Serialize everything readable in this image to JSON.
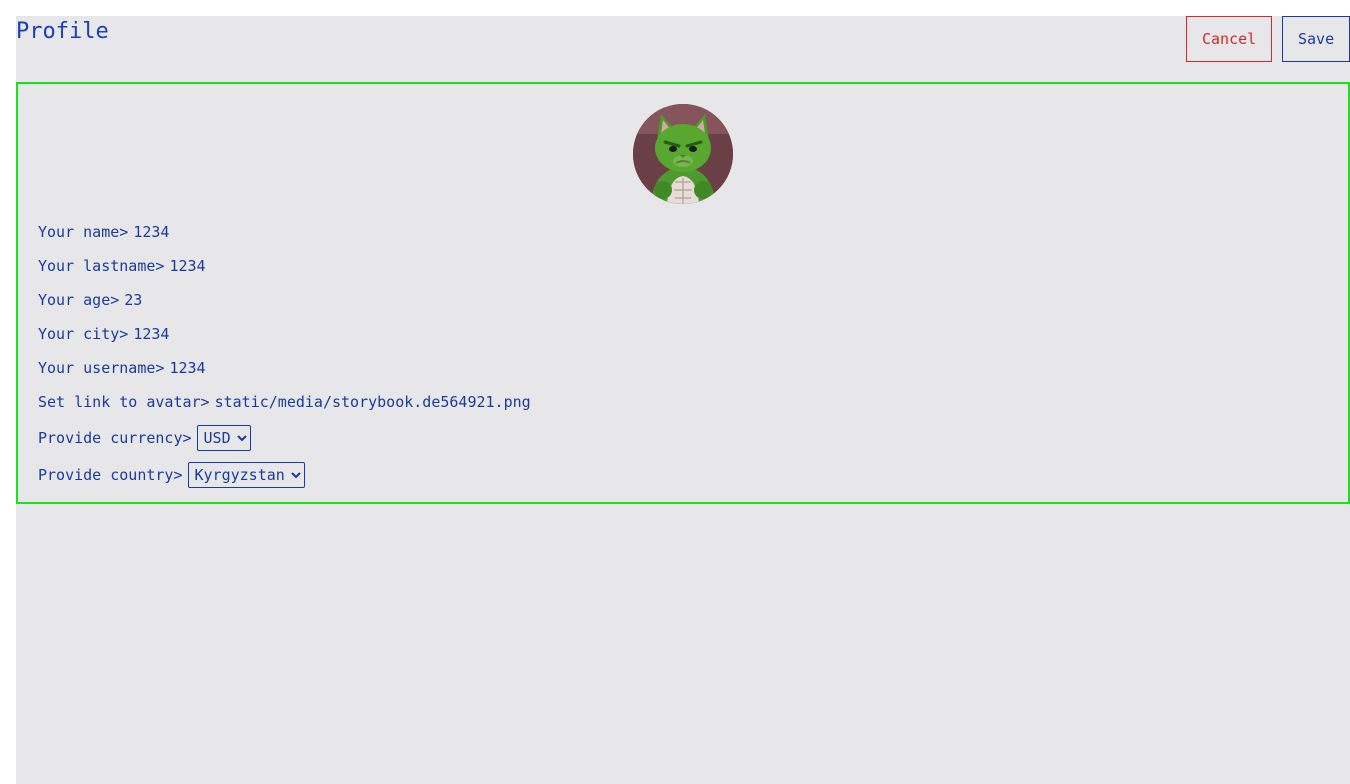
{
  "header": {
    "title": "Profile",
    "cancel_label": "Cancel",
    "save_label": "Save"
  },
  "profile": {
    "fields": [
      {
        "label": "Your name>",
        "value": "1234"
      },
      {
        "label": "Your lastname>",
        "value": "1234"
      },
      {
        "label": "Your age>",
        "value": "23"
      },
      {
        "label": "Your city>",
        "value": "1234"
      },
      {
        "label": "Your username>",
        "value": "1234"
      },
      {
        "label": "Set link to avatar>",
        "value": "static/media/storybook.de564921.png"
      }
    ],
    "currency": {
      "label": "Provide currency>",
      "selected": "USD"
    },
    "country": {
      "label": "Provide country>",
      "selected": "Kyrgyzstan"
    }
  },
  "colors": {
    "accent": "#1a3a9c",
    "cancel": "#d22a2a",
    "card_border": "#19e219",
    "background": "#e7e7ea"
  }
}
